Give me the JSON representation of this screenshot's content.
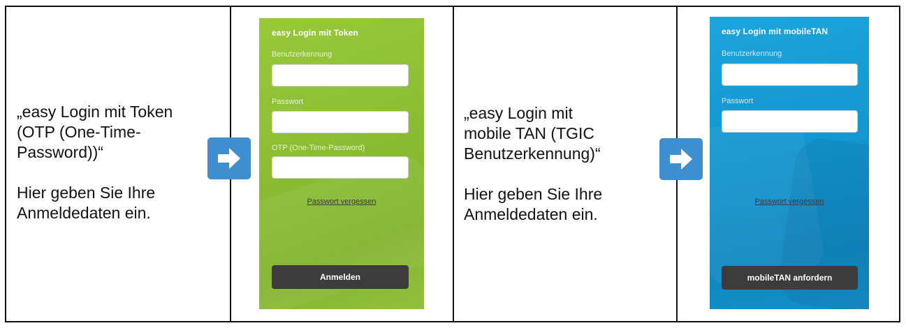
{
  "left_caption": "„easy Login mit Token\n(OTP (One-Time-\nPassword))“\n\nHier geben Sie Ihre\nAnmeldedaten ein.",
  "right_caption": "„easy Login mit\nmobile TAN (TGIC\nBenutzerkennung)“\n\nHier geben Sie Ihre\nAnmeldedaten ein.",
  "arrow_icon": "arrow-right-icon",
  "colors": {
    "arrow": "#3e8ed0",
    "green_panel": "#8dbe34",
    "blue_panel": "#1496d0",
    "button": "#3c3c3c"
  },
  "token_login": {
    "title": "easy Login mit Token",
    "username_label": "Benutzerkennung",
    "password_label": "Passwort",
    "otp_label": "OTP (One-Time-Password)",
    "forgot_link": "Passwort vergessen",
    "submit_label": "Anmelden"
  },
  "mobiletan_login": {
    "title": "easy Login mit mobileTAN",
    "username_label": "Benutzerkennung",
    "password_label": "Passwort",
    "forgot_link": "Passwort vergessen",
    "submit_label": "mobileTAN anfordern"
  }
}
